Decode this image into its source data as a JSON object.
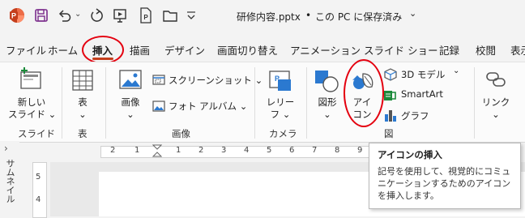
{
  "titlebar": {
    "filename": "研修内容.pptx",
    "sep": "•",
    "location": "この PC に保存済み",
    "location_caret": "⌄",
    "icons": [
      "powerpoint-logo",
      "save-icon",
      "undo-icon",
      "redo-icon",
      "present-icon",
      "pdf-icon",
      "folder-icon",
      "qat-more-icon"
    ]
  },
  "tabs": [
    "ファイル",
    "ホーム",
    "挿入",
    "描画",
    "デザイン",
    "画面切り替え",
    "アニメーション",
    "スライド ショー",
    "記録",
    "校閲",
    "表示"
  ],
  "ribbon": {
    "new_slide": [
      "新しい",
      "スライド ⌄"
    ],
    "table": [
      "表",
      "⌄"
    ],
    "images": [
      "画像",
      "⌄"
    ],
    "screenshot": "スクリーンショット ⌄",
    "photo_album": "フォト アルバム ⌄",
    "cameo": [
      "レリー",
      "フ ⌄"
    ],
    "shapes": [
      "図形",
      "⌄"
    ],
    "icons": [
      "アイ",
      "コン"
    ],
    "models_3d": "3D モデル",
    "models_3d_caret": "⌄",
    "smartart": "SmartArt",
    "chart": "グラフ",
    "link": [
      "リンク",
      "⌄"
    ],
    "groups": {
      "slides": "スライド",
      "table": "表",
      "images": "画像",
      "camera": "カメラ",
      "illustrations": "図"
    }
  },
  "ruler": {
    "ticks": [
      "2",
      "1",
      "1",
      "2",
      "3",
      "4",
      "5",
      "6",
      "7",
      "8",
      "9",
      "10",
      "11",
      "12",
      "13",
      "14",
      "15",
      "16"
    ]
  },
  "thumbnail_label": "サムネイル",
  "vruler": [
    "5",
    "4"
  ],
  "tooltip": {
    "title": "アイコンの挿入",
    "body": "記号を使用して、視覚的にコミュニケーションするためのアイコンを挿入します。"
  },
  "colors": {
    "powerpoint": "#c43e1c",
    "accent": "#7a2b8b",
    "annotation": "#e4000f",
    "icon_blue": "#2b79d0"
  }
}
